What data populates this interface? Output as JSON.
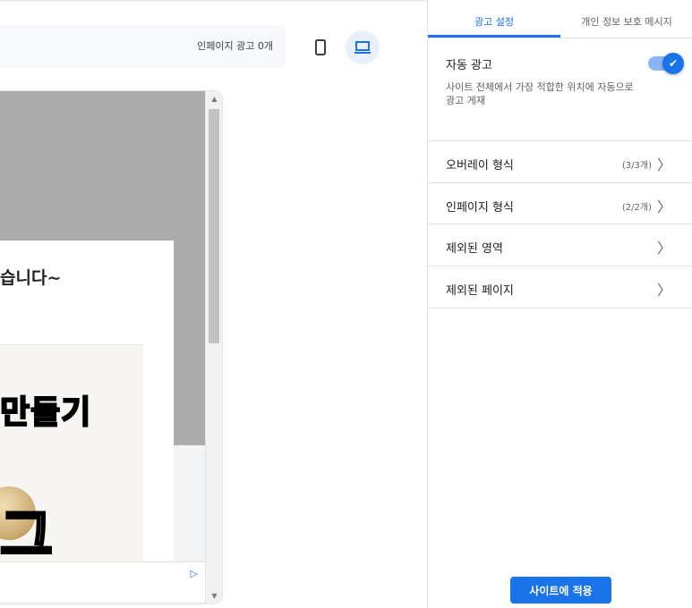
{
  "toolbar": {
    "inpage_count": "인페이지 광고 0개"
  },
  "preview": {
    "headline": "습니다~",
    "thumb_title": "만들기",
    "thumb_big": "그",
    "adchoices": "▷"
  },
  "panel": {
    "tabs": [
      {
        "label": "광고 설정",
        "active": true
      },
      {
        "label": "개인 정보 보호 메시지",
        "active": false
      }
    ],
    "auto_ads": {
      "title": "자동 광고",
      "desc": "사이트 전체에서 가장 적합한 위치에 자동으로 광고 게재",
      "enabled": true
    },
    "rows": [
      {
        "label": "오버레이 형식",
        "meta": "(3/3개)"
      },
      {
        "label": "인페이지 형식",
        "meta": "(2/2개)"
      },
      {
        "label": "제외된 영역",
        "meta": ""
      },
      {
        "label": "제외된 페이지",
        "meta": ""
      }
    ],
    "apply_label": "사이트에 적용"
  },
  "colors": {
    "accent": "#1a73e8",
    "toggle_track": "#8ab4f8"
  }
}
